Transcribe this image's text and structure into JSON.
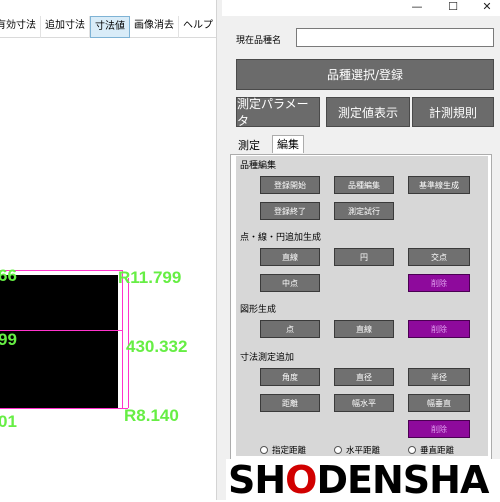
{
  "toolbar": {
    "items": [
      "有効寸法",
      "追加寸法",
      "寸法値",
      "画像消去",
      "ヘルプ"
    ]
  },
  "measurements": {
    "top_left": "66",
    "mid_left": "99",
    "bottom_left": "01",
    "top_right": "R11.799",
    "mid_right": "430.332",
    "bottom_right": "R8.140"
  },
  "window": {
    "minimize": "—",
    "maximize": "☐",
    "close": "✕"
  },
  "product": {
    "label": "現在品種名",
    "value": ""
  },
  "buttons": {
    "select_register": "品種選択/登録",
    "measure_params": "測定パラメータ",
    "show_values": "測定値表示",
    "rules": "計測規則"
  },
  "tabs": [
    "測定",
    "編集"
  ],
  "edit": {
    "group1_title": "品種編集",
    "register_start": "登録開始",
    "product_edit": "品種編集",
    "baseline_create": "基準線生成",
    "register_end": "登録終了",
    "trial_measure": "測定試行",
    "group2_title": "点・線・円追加生成",
    "line": "直線",
    "circle": "円",
    "intersection": "交点",
    "midpoint": "中点",
    "delete1": "削除",
    "group3_title": "図形生成",
    "point": "点",
    "line2": "直線",
    "delete2": "削除",
    "group4_title": "寸法測定追加",
    "angle": "角度",
    "diameter": "直径",
    "radius": "半径",
    "distance": "距離",
    "h_width": "幅水平",
    "v_width": "幅垂直",
    "delete3": "削除",
    "radio1": "指定距離",
    "radio2": "水平距離",
    "radio3": "垂直距離"
  },
  "logo": {
    "part1": "SH",
    "part2": "O",
    "part3": "DENSHA"
  }
}
